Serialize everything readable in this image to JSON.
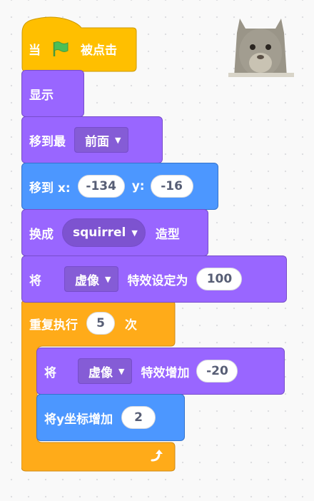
{
  "script": {
    "hat": {
      "prefix": "当",
      "suffix": "被点击"
    },
    "show": {
      "label": "显示"
    },
    "go_layer": {
      "label": "移到最",
      "option": "前面"
    },
    "goto_xy": {
      "label": "移到 x:",
      "x": "-134",
      "y_label": "y:",
      "y": "-16"
    },
    "switch_costume": {
      "prefix": "换成",
      "costume": "squirrel",
      "suffix": "造型"
    },
    "set_effect": {
      "prefix": "将",
      "effect": "虚像",
      "suffix": "特效设定为",
      "value": "100"
    },
    "repeat": {
      "label": "重复执行",
      "times": "5",
      "suffix": "次"
    },
    "change_effect": {
      "prefix": "将",
      "effect": "虚像",
      "suffix": "特效增加",
      "value": "-20"
    },
    "change_y": {
      "label": "将y坐标增加",
      "value": "2"
    }
  },
  "colors": {
    "looks": "#9966ff",
    "motion": "#4c97ff",
    "events": "#ffbf00",
    "control": "#ffab19"
  },
  "icons": [
    "green-flag-icon",
    "dropdown-caret-icon",
    "loop-arrow-icon",
    "squirrel-sprite-thumbnail"
  ]
}
